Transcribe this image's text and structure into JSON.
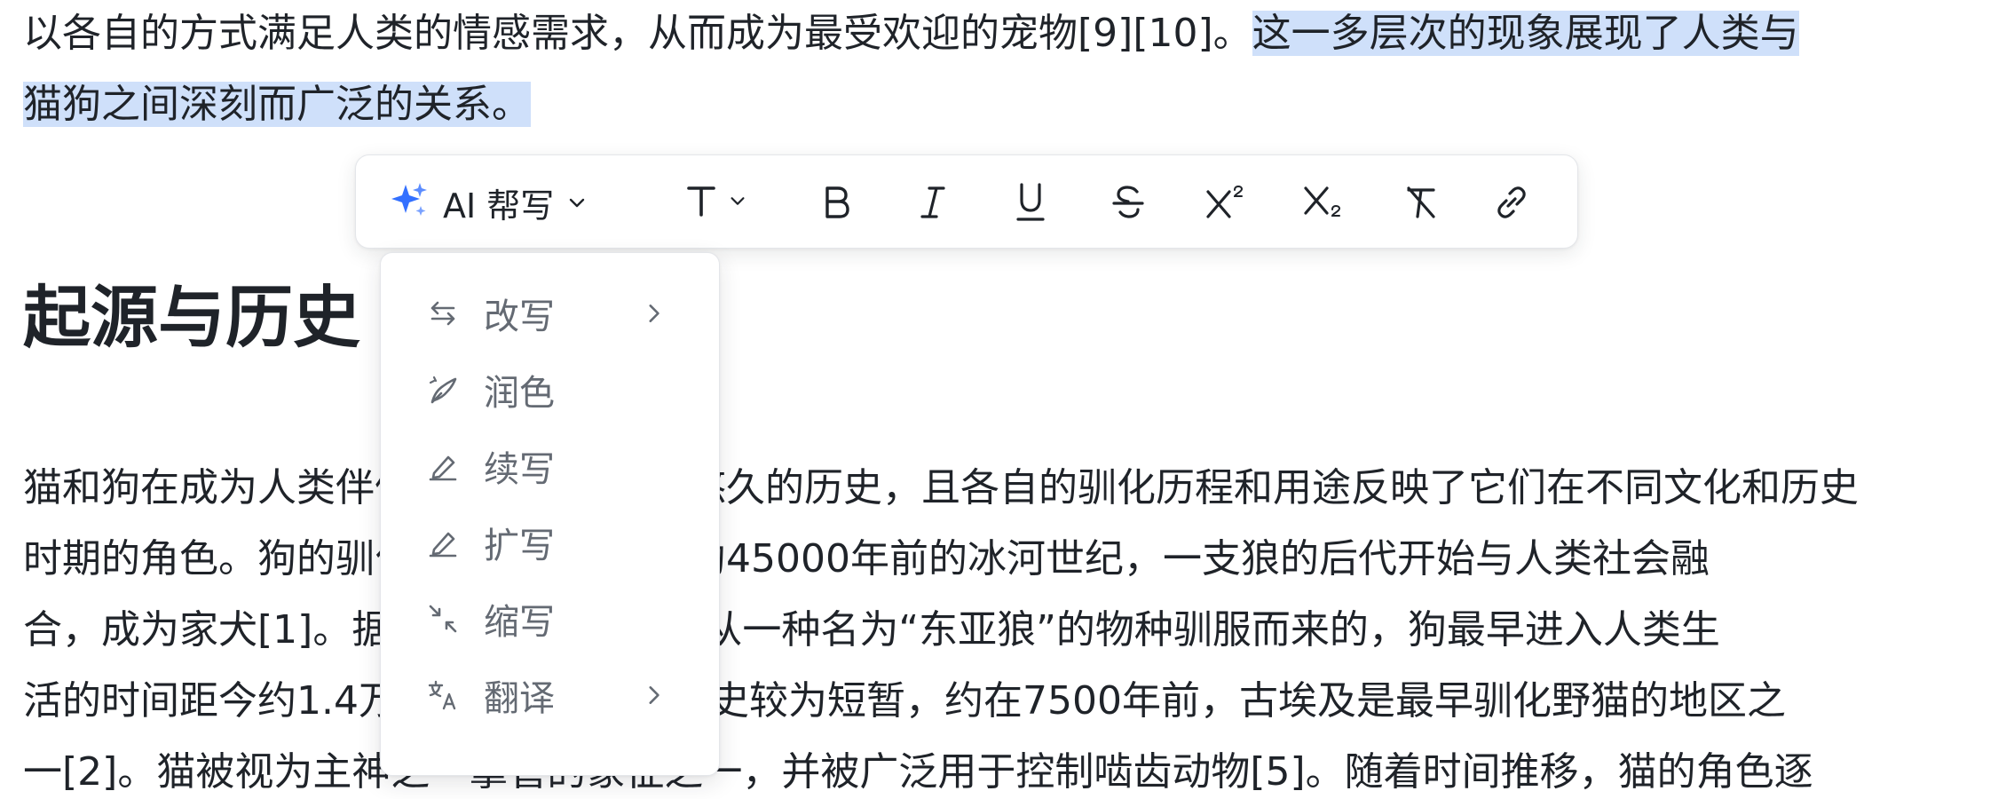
{
  "document": {
    "line1_plain": "以各自的方式满足人类的情感需求，从而成为最受欢迎的宠物[9][10]。",
    "line1_selected": "这一多层次的现象展现了人类与",
    "line2_selected": "猫狗之间深刻而广泛的关系。",
    "heading": "起源与历史",
    "body_lines": [
      "猫和狗在成为人类伴侣的过程中都有着悠久的历史，且各自的驯化历程和用途反映了它们在不同文化和历史",
      "时期的角色。狗的驯化历史可以追溯到约45000年前的冰河世纪，一支狼的后代开始与人类社会融",
      "合，成为家犬[1]。据研究，今天的狗是从一种名为“东亚狼”的物种驯服而来的，狗最早进入人类生",
      "活的时间距今约1.4万年前。猫的驯化历史较为短暂，约在7500年前，古埃及是最早驯化野猫的地区之",
      "一[2]。猫被视为主神之一掌管的象征之一，并被广泛用于控制啮齿动物[5]。随着时间推移，猫的角色逐"
    ]
  },
  "toolbar": {
    "ai_label": "AI 帮写",
    "icons": {
      "ai": "sparkle-icon",
      "text_style": "text-style-icon",
      "bold": "bold-icon",
      "italic": "italic-icon",
      "underline": "underline-icon",
      "strikethrough": "strikethrough-icon",
      "superscript": "superscript-icon",
      "subscript": "subscript-icon",
      "clear_format": "clear-format-icon",
      "link": "link-icon"
    },
    "accent_color": "#3370ff"
  },
  "menu": {
    "items": [
      {
        "label": "改写",
        "icon": "swap-icon",
        "has_submenu": true
      },
      {
        "label": "润色",
        "icon": "brush-icon",
        "has_submenu": false
      },
      {
        "label": "续写",
        "icon": "pen-icon",
        "has_submenu": false
      },
      {
        "label": "扩写",
        "icon": "pen-icon",
        "has_submenu": false
      },
      {
        "label": "缩写",
        "icon": "shrink-icon",
        "has_submenu": false
      },
      {
        "label": "翻译",
        "icon": "translate-icon",
        "has_submenu": true
      }
    ]
  },
  "colors": {
    "selection": "#cfe0fa",
    "text": "#1f2329",
    "menu_text": "#646a73"
  }
}
